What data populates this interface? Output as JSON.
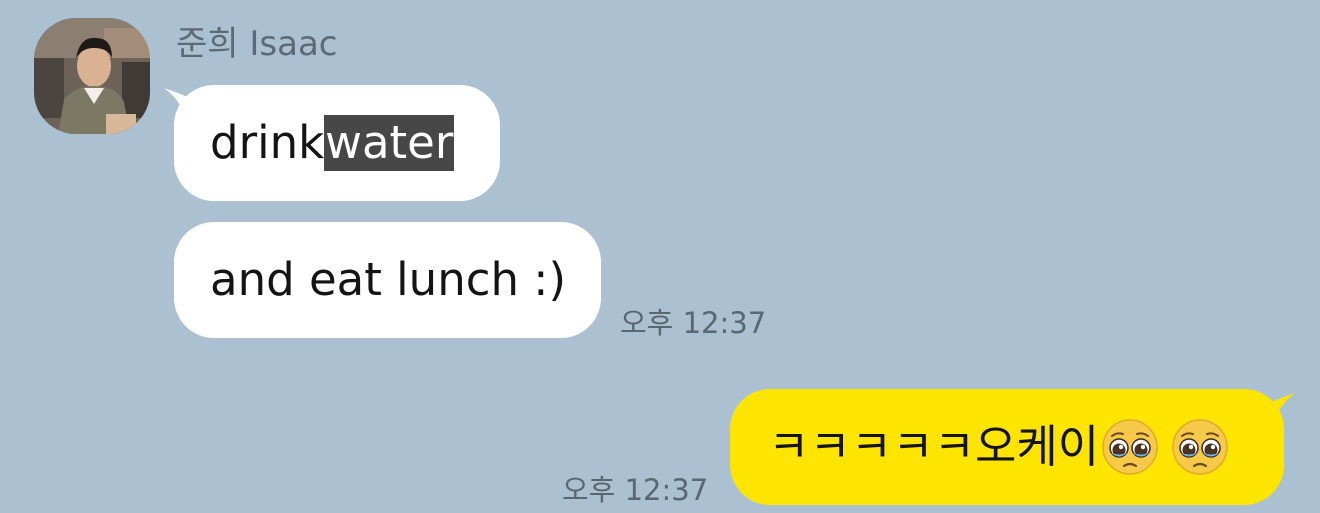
{
  "sender": {
    "name": "준희 Isaac"
  },
  "messages": [
    {
      "text_before": "drink ",
      "highlighted": "water"
    },
    {
      "text": "and eat lunch :)",
      "time": "오후 12:37"
    }
  ],
  "my_message": {
    "text": "ㅋㅋㅋㅋㅋ오케이",
    "emojis": [
      "pleading-face",
      "pleading-face"
    ],
    "time": "오후 12:37"
  },
  "colors": {
    "background": "#abc1d2",
    "incoming_bubble": "#ffffff",
    "outgoing_bubble": "#fee500",
    "selection_highlight": "#474747"
  }
}
